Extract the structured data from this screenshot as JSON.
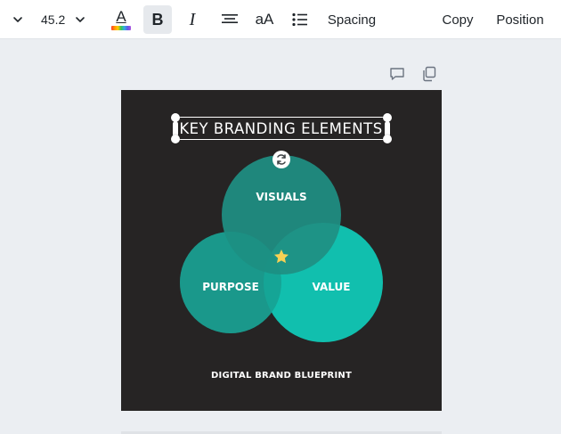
{
  "toolbar": {
    "font_size": "45.2",
    "bold_label": "B",
    "italic_label": "I",
    "case_label": "aA",
    "color_letter": "A",
    "spacing_label": "Spacing",
    "copy_label": "Copy",
    "position_label": "Position",
    "icons": [
      "chevron-down-icon",
      "text-color-icon",
      "align-center-icon",
      "list-icon"
    ]
  },
  "canvas": {
    "icons": [
      "comment-icon",
      "duplicate-icon"
    ]
  },
  "design": {
    "background": "#262424",
    "title": "KEY BRANDING ELEMENTS",
    "circles": [
      {
        "label": "VISUALS",
        "color": "#1f8f83"
      },
      {
        "label": "PURPOSE",
        "color": "#1ba294"
      },
      {
        "label": "VALUE",
        "color": "#11bfae"
      }
    ],
    "center_icon": "star-icon",
    "star_color": "#f7d154",
    "footer": "DIGITAL BRAND BLUEPRINT"
  }
}
